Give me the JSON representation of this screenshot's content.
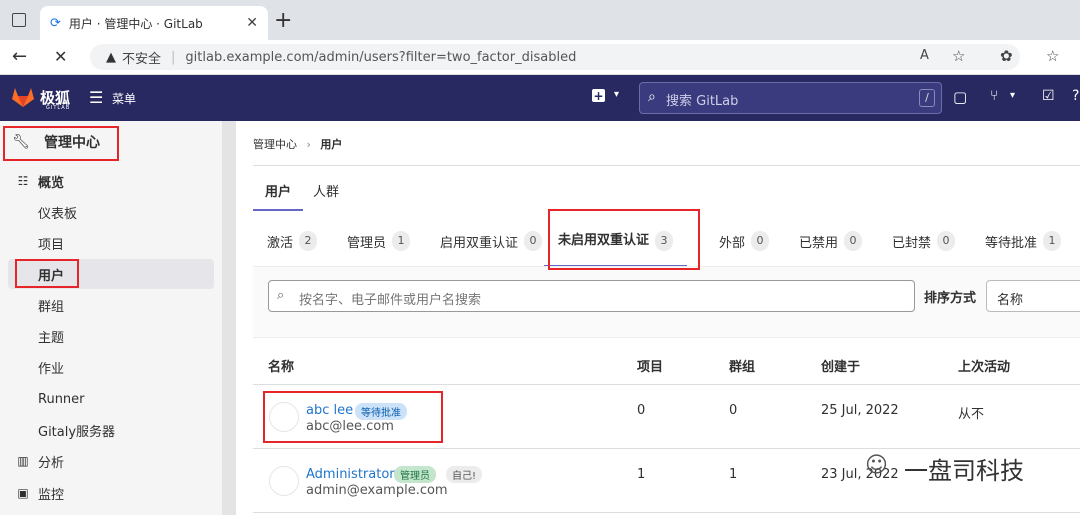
{
  "browser": {
    "tab_title": "用户 · 管理中心 · GitLab",
    "url_warning": "不安全",
    "url": "gitlab.example.com/admin/users?filter=two_factor_disabled"
  },
  "topnav": {
    "brand": "极狐",
    "brand_sub": "GITLAB",
    "menu_label": "菜单",
    "search_placeholder": "搜索 GitLab",
    "search_shortcut": "/"
  },
  "sidebar": {
    "header": "管理中心",
    "overview": "概览",
    "items": [
      "仪表板",
      "项目",
      "用户",
      "群组",
      "主题",
      "作业",
      "Runner",
      "Gitaly服务器"
    ],
    "analytics": "分析",
    "monitoring": "监控"
  },
  "breadcrumb": {
    "parent": "管理中心",
    "current": "用户"
  },
  "page_tabs": [
    "用户",
    "人群"
  ],
  "filter_tabs": [
    {
      "label": "激活",
      "count": "2"
    },
    {
      "label": "管理员",
      "count": "1"
    },
    {
      "label": "启用双重认证",
      "count": "0"
    },
    {
      "label": "未启用双重认证",
      "count": "3"
    },
    {
      "label": "外部",
      "count": "0"
    },
    {
      "label": "已禁用",
      "count": "0"
    },
    {
      "label": "已封禁",
      "count": "0"
    },
    {
      "label": "等待批准",
      "count": "1"
    }
  ],
  "search": {
    "placeholder": "按名字、电子邮件或用户名搜索",
    "sort_label": "排序方式",
    "sort_value": "名称"
  },
  "table": {
    "headers": [
      "名称",
      "项目",
      "群组",
      "创建于",
      "上次活动"
    ],
    "rows": [
      {
        "name": "abc lee",
        "badge": "等待批准",
        "badge2": "",
        "email": "abc@lee.com",
        "projects": "0",
        "groups": "0",
        "created": "25 Jul, 2022",
        "last": "从不"
      },
      {
        "name": "Administrator",
        "badge": "管理员",
        "badge2": "自己!",
        "email": "admin@example.com",
        "projects": "1",
        "groups": "1",
        "created": "23 Jul, 2022",
        "last": ""
      }
    ]
  },
  "watermark": "一盘司科技",
  "colors": {
    "nav": "#292961",
    "accent": "#6666c4",
    "link": "#1f75cb",
    "highlight": "#e5252a"
  }
}
